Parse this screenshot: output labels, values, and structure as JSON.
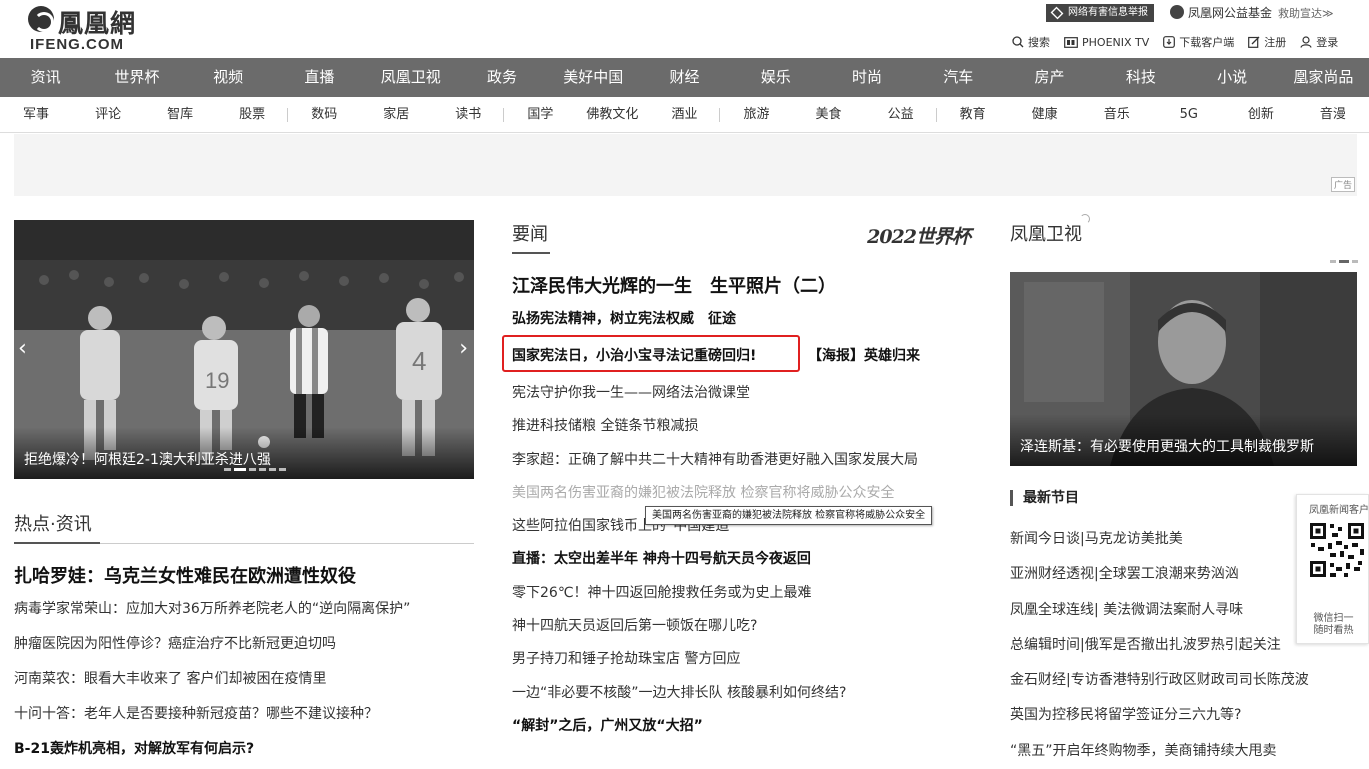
{
  "header": {
    "logo_cn": "鳳凰網",
    "logo_en": "IFENG.COM",
    "report_label": "网络有害信息举报",
    "charity_label": "凤凰网公益基金",
    "charity_sub": "救助宣达≫",
    "toolbar": {
      "search": "搜索",
      "phoenix_tv": "PHOENIX TV",
      "download": "下载客户端",
      "register": "注册",
      "login": "登录"
    }
  },
  "nav_main": [
    "资讯",
    "世界杯",
    "视频",
    "直播",
    "凤凰卫视",
    "政务",
    "美好中国",
    "财经",
    "娱乐",
    "时尚",
    "汽车",
    "房产",
    "科技",
    "小说",
    "凰家尚品"
  ],
  "nav_sub": [
    "军事",
    "评论",
    "智库",
    "股票",
    "数码",
    "家居",
    "读书",
    "国学",
    "佛教文化",
    "酒业",
    "旅游",
    "美食",
    "公益",
    "教育",
    "健康",
    "音乐",
    "5G",
    "创新",
    "音漫"
  ],
  "ad": {
    "label": "广告"
  },
  "carousel": {
    "caption": "拒绝爆冷！阿根廷2-1澳大利亚杀进八强",
    "prev": "‹",
    "next": "›"
  },
  "hot": {
    "title": "热点·资讯",
    "feature": "扎哈罗娃：乌克兰女性难民在欧洲遭性奴役",
    "items": [
      "病毒学家常荣山：应加大对36万所养老院老人的“逆向隔离保护”",
      "肿瘤医院因为阳性停诊？癌症治疗不比新冠更迫切吗",
      "河南菜农：眼看大丰收来了 客户们却被困在疫情里",
      "十问十答：老年人是否要接种新冠疫苗？哪些不建议接种？",
      "B-21轰炸机亮相，对解放军有何启示?"
    ]
  },
  "news": {
    "title": "要闻",
    "worldcup": "2022世界杯",
    "headline": "江泽民伟大光辉的一生　生平照片（二）",
    "sub1": "弘扬宪法精神，树立宪法权威　征途",
    "sub2": "国家宪法日，小治小宝寻法记重磅回归!",
    "sub2b": "【海报】英雄归来",
    "items": [
      "宪法守护你我一生——网络法治微课堂",
      "推进科技储粮 全链条节粮减损",
      "李家超：正确了解中共二十大精神有助香港更好融入国家发展大局",
      "美国两名伤害亚裔的嫌犯被法院释放 检察官称将威胁公众安全",
      "这些阿拉伯国家钱币上的“中国建造”",
      "直播：太空出差半年 神舟十四号航天员今夜返回",
      "零下26℃！神十四返回舱搜救任务或为史上最难",
      "神十四航天员返回后第一顿饭在哪儿吃?",
      "男子持刀和锤子抢劫珠宝店 警方回应",
      "一边“非必要不核酸”一边大排长队 核酸暴利如何终结?",
      "“解封”之后，广州又放“大招”"
    ],
    "tooltip": "美国两名伤害亚裔的嫌犯被法院释放 检察官称将威胁公众安全"
  },
  "tv": {
    "title": "凤凰卫视",
    "caption": "泽连斯基：有必要使用更强大的工具制裁俄罗斯",
    "programs_title": "最新节目",
    "programs": [
      "新闻今日谈|马克龙访美批美",
      "亚洲财经透视|全球罢工浪潮来势汹汹",
      "凤凰全球连线| 美法微调法案耐人寻味",
      "总编辑时间|俄军是否撤出扎波罗热引起关注",
      "金石财经|专访香港特别行政区财政司司长陈茂波",
      "英国为控移民将留学签证分三六九等?",
      "“黑五”开启年终购物季，美商铺持续大甩卖"
    ]
  },
  "qr": {
    "top": "凤凰新闻客户端",
    "bottom1": "微信扫一",
    "bottom2": "随时看热"
  }
}
